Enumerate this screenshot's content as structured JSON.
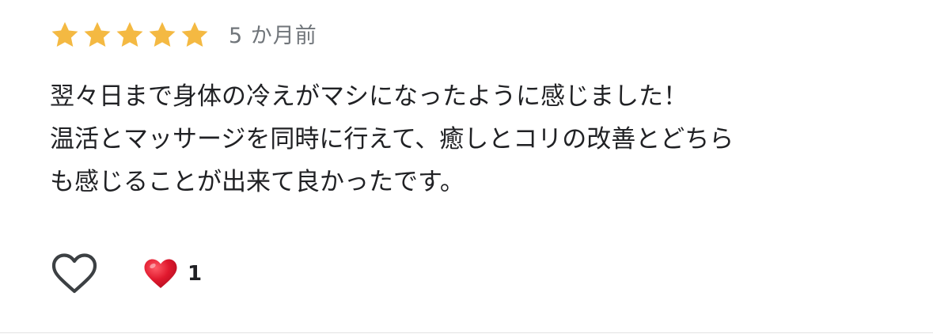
{
  "review": {
    "rating": 5,
    "rating_max": 5,
    "time_ago": "5 か月前",
    "text_lines": [
      "翌々日まで身体の冷えがマシになったように感じました！",
      "温活とマッサージを同時に行えて、癒しとコリの改善とどちら",
      "も感じることが出来て良かったです。"
    ],
    "reaction_count": "1",
    "colors": {
      "star": "#F4B942",
      "heart_filled": "#E0182D",
      "heart_outline": "#3C4043",
      "time_text": "#70757A",
      "body_text": "#202124"
    },
    "icons": {
      "star": "star-icon",
      "like": "heart-outline-icon",
      "reaction": "heart-filled-icon"
    }
  }
}
